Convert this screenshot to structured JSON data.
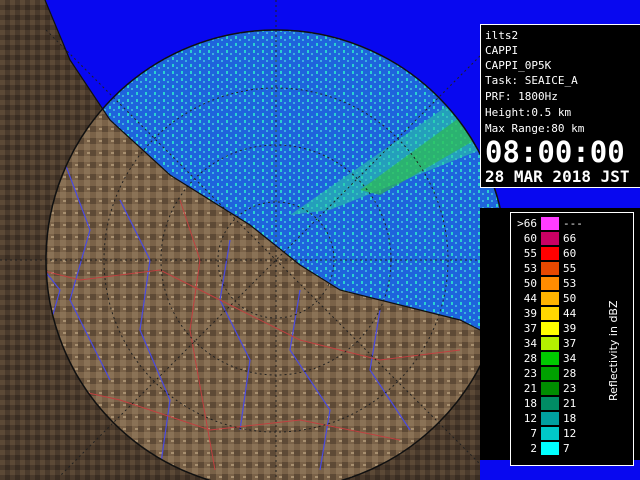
{
  "info": {
    "station": "ilts2",
    "product": "CAPPI",
    "product_code": "CAPPI_0P5K",
    "task": "Task: SEAICE_A",
    "prf": "PRF: 1800Hz",
    "height": "Height:0.5 km",
    "range": "Max Range:80 km",
    "time": "08:00:00",
    "date": "28 MAR 2018 JST"
  },
  "legend": {
    "title": "Reflectivity in dBZ",
    "rows": [
      {
        "lo": ">66",
        "hi": "---",
        "color": "#ff3cff"
      },
      {
        "lo": "60",
        "hi": "66",
        "color": "#c80064"
      },
      {
        "lo": "55",
        "hi": "60",
        "color": "#ff0000"
      },
      {
        "lo": "53",
        "hi": "55",
        "color": "#e84800"
      },
      {
        "lo": "50",
        "hi": "53",
        "color": "#ff8c00"
      },
      {
        "lo": "44",
        "hi": "50",
        "color": "#ffb400"
      },
      {
        "lo": "39",
        "hi": "44",
        "color": "#ffd700"
      },
      {
        "lo": "37",
        "hi": "39",
        "color": "#ffff00"
      },
      {
        "lo": "34",
        "hi": "37",
        "color": "#b4f000"
      },
      {
        "lo": "28",
        "hi": "34",
        "color": "#00c800"
      },
      {
        "lo": "23",
        "hi": "28",
        "color": "#00a000"
      },
      {
        "lo": "21",
        "hi": "23",
        "color": "#008c00"
      },
      {
        "lo": "18",
        "hi": "21",
        "color": "#008c64"
      },
      {
        "lo": "12",
        "hi": "18",
        "color": "#00a0a0"
      },
      {
        "lo": "7",
        "hi": "12",
        "color": "#00c8c8"
      },
      {
        "lo": "2",
        "hi": "7",
        "color": "#00ffff"
      }
    ]
  }
}
